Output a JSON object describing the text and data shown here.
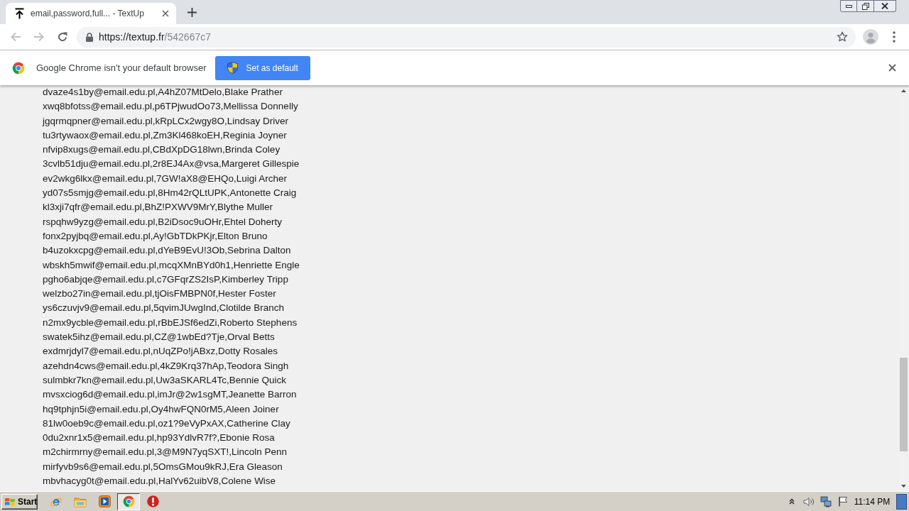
{
  "browser": {
    "tabs": [
      {
        "title": "email,password,full... - TextUp",
        "selected": true
      }
    ],
    "navigation": [
      {
        "kind": "back",
        "disabled": true
      },
      {
        "kind": "forward",
        "disabled": true
      },
      {
        "kind": "reload",
        "disabled": false
      }
    ],
    "address_bar": {
      "url_host": "https://textup.fr",
      "url_path": "/542667c7"
    }
  },
  "infobar": {
    "message": "Google Chrome isn't your default browser",
    "button": "Set as default"
  },
  "page": {
    "lines": [
      "dvaze4s1by@email.edu.pl,A4hZ07MtDelo,Blake Prather",
      "xwq8bfotss@email.edu.pl,p6TPjwudOo73,Mellissa Donnelly",
      "jgqrmqpner@email.edu.pl,kRpLCx2wgy8O,Lindsay Driver",
      "tu3rtywaox@email.edu.pl,Zm3Kl468koEH,Reginia Joyner",
      "nfvip8xugs@email.edu.pl,CBdXpDG18lwn,Brinda Coley",
      "3cvlb51dju@email.edu.pl,2r8EJ4Ax@vsa,Margeret Gillespie",
      "ev2wkg6lkx@email.edu.pl,7GW!aX8@EHQo,Luigi Archer",
      "yd07s5smjg@email.edu.pl,8Hm42rQLtUPK,Antonette Craig",
      "kl3xji7qfr@email.edu.pl,BhZ!PXWV9MrY,Blythe Muller",
      "rspqhw9yzg@email.edu.pl,B2iDsoc9uOHr,Ehtel Doherty",
      "fonx2pyjbq@email.edu.pl,Ay!GbTDkPKjr,Elton Bruno",
      "b4uzokxcpg@email.edu.pl,dYeB9EvU!3Ob,Sebrina Dalton",
      "wbskh5mwif@email.edu.pl,mcqXMnBYd0h1,Henriette Engle",
      "pgho6abjqe@email.edu.pl,c7GFqrZS2IsP,Kimberley Tripp",
      "welzbo27in@email.edu.pl,tjOisFMBPN0f,Hester Foster",
      "ys6czuvjv9@email.edu.pl,5qvimJUwgInd,Clotilde Branch",
      "n2mx9ycble@email.edu.pl,rBbEJSf6edZi,Roberto Stephens",
      "swatek5ihz@email.edu.pl,CZ@1wbEd?Tje,Orval Betts",
      "exdmrjdyl7@email.edu.pl,nUqZPo!jABxz,Dotty Rosales",
      "azehdn4cws@email.edu.pl,4kZ9Krq37hAp,Teodora Singh",
      "sulmbkr7kn@email.edu.pl,Uw3aSKARL4Tc,Bennie Quick",
      "mvsxciog6d@email.edu.pl,imJr@2w1sgMT,Jeanette Barron",
      "hq9tphjn5i@email.edu.pl,Oy4hwFQN0rM5,Aleen Joiner",
      "81lw0oeb9c@email.edu.pl,oz1?9eVyPxAX,Catherine Clay",
      "0du2xnr1x5@email.edu.pl,hp93YdlvR7f?,Ebonie Rosa",
      "m2chirmrny@email.edu.pl,3@M9N7yqSXT!,Lincoln Penn",
      "mirfyvb9s6@email.edu.pl,5OmsGMou9kRJ,Era Gleason",
      "mbvhacyg0t@email.edu.pl,HalYv62uibV8,Colene Wise"
    ]
  },
  "taskbar": {
    "start_button": "Start",
    "apps": [
      {
        "kind": "ie",
        "selected": false
      },
      {
        "kind": "explorer",
        "selected": false
      },
      {
        "kind": "mediaplayer",
        "selected": false
      },
      {
        "kind": "chrome",
        "selected": true
      },
      {
        "kind": "alert",
        "selected": false
      }
    ],
    "clock": "11:14 PM"
  }
}
